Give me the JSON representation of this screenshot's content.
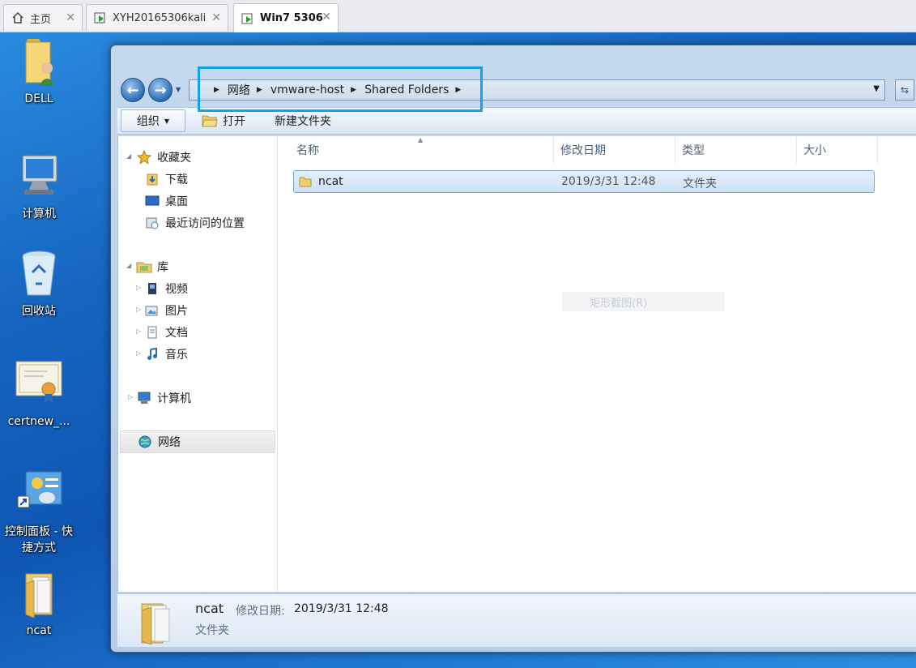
{
  "vmware_tabs": [
    {
      "label": "主页",
      "icon": "home-icon"
    },
    {
      "label": "XYH20165306kali",
      "icon": "vm-icon"
    },
    {
      "label": "Win7 5306",
      "icon": "vm-icon"
    }
  ],
  "desktop_icons": [
    {
      "label": "DELL",
      "icon": "user-folder-icon"
    },
    {
      "label": "计算机",
      "icon": "computer-icon"
    },
    {
      "label": "回收站",
      "icon": "recycle-bin-icon"
    },
    {
      "label": "certnew_...",
      "icon": "certificate-icon"
    },
    {
      "label": "控制面板 - 快捷方式",
      "icon": "control-panel-shortcut-icon"
    },
    {
      "label": "ncat",
      "icon": "folder-icon"
    }
  ],
  "address": {
    "crumbs": [
      "网络",
      "vmware-host",
      "Shared Folders"
    ]
  },
  "toolbar": {
    "organize": "组织",
    "open": "打开",
    "new_folder": "新建文件夹"
  },
  "nav": {
    "favorites": "收藏夹",
    "downloads": "下载",
    "desktop": "桌面",
    "recent": "最近访问的位置",
    "libraries": "库",
    "videos": "视频",
    "pictures": "图片",
    "documents": "文档",
    "music": "音乐",
    "computer": "计算机",
    "network": "网络"
  },
  "columns": {
    "name": "名称",
    "modified": "修改日期",
    "type": "类型",
    "size": "大小"
  },
  "files": [
    {
      "name": "ncat",
      "modified": "2019/3/31 12:48",
      "type": "文件夹",
      "size": ""
    }
  ],
  "context_ghost": "矩形截图(R)",
  "details": {
    "name": "ncat",
    "modified_label": "修改日期:",
    "modified_value": "2019/3/31 12:48",
    "type": "文件夹"
  },
  "colors": {
    "highlight_box": "#13a2e8",
    "selection": "#cde1f7"
  }
}
